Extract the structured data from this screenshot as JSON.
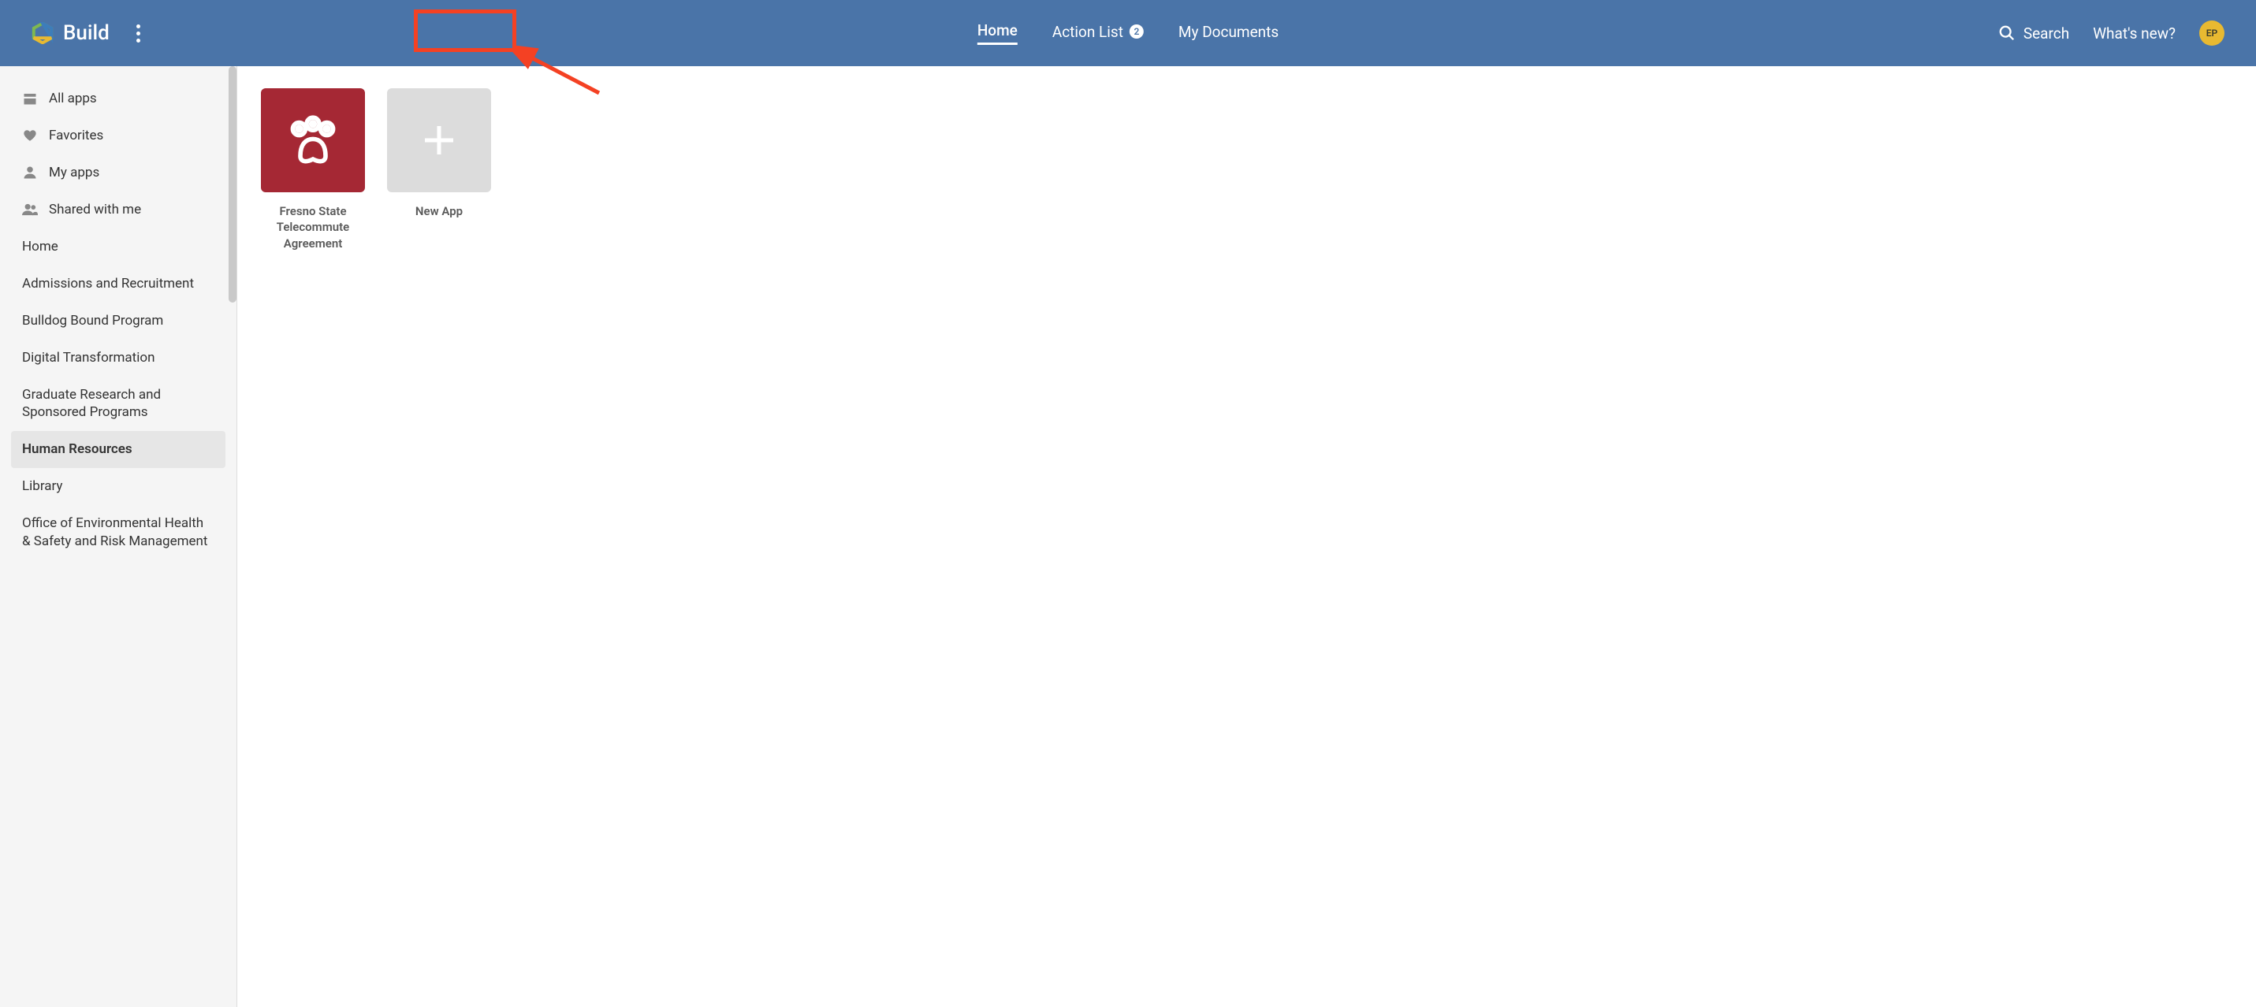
{
  "header": {
    "brand": "Build",
    "nav": {
      "home": "Home",
      "action_list": "Action List",
      "action_list_badge": "2",
      "my_docs": "My Documents"
    },
    "search_label": "Search",
    "whats_new": "What's new?",
    "avatar_initials": "EP"
  },
  "sidebar": {
    "all_apps": "All apps",
    "favorites": "Favorites",
    "my_apps": "My apps",
    "shared": "Shared with me",
    "categories": [
      "Home",
      "Admissions and Recruitment",
      "Bulldog Bound Program",
      "Digital Transformation",
      "Graduate Research and Sponsored Programs",
      "Human Resources",
      "Library",
      "Office of Environmental Health & Safety and Risk Management"
    ],
    "selected_index": 5
  },
  "apps": {
    "card1_label": "Fresno State Telecommute Agreement",
    "new_app_label": "New App"
  },
  "colors": {
    "header_bg": "#4a74a8",
    "tile_red": "#a52834",
    "avatar_bg": "#e8b931",
    "annotation": "#f44123"
  }
}
